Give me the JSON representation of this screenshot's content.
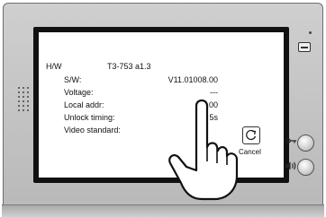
{
  "info": {
    "hw_label": "H/W",
    "hw_value": "T3-753  a1.3",
    "rows": [
      {
        "label": "S/W:",
        "value": "V11.01008.00"
      },
      {
        "label": "Voltage:",
        "value": "---"
      },
      {
        "label": "Local addr:",
        "value": "01.00"
      },
      {
        "label": "Unlock timing:",
        "value": "5s"
      },
      {
        "label": "Video standard:",
        "value": ""
      }
    ]
  },
  "cancel": {
    "label": "Cancel"
  },
  "icons": {
    "cancel": "refresh-icon",
    "unlock_button": "key-icon",
    "talk_button": "speaker-volume-icon",
    "hand": "pointing-hand-icon"
  }
}
